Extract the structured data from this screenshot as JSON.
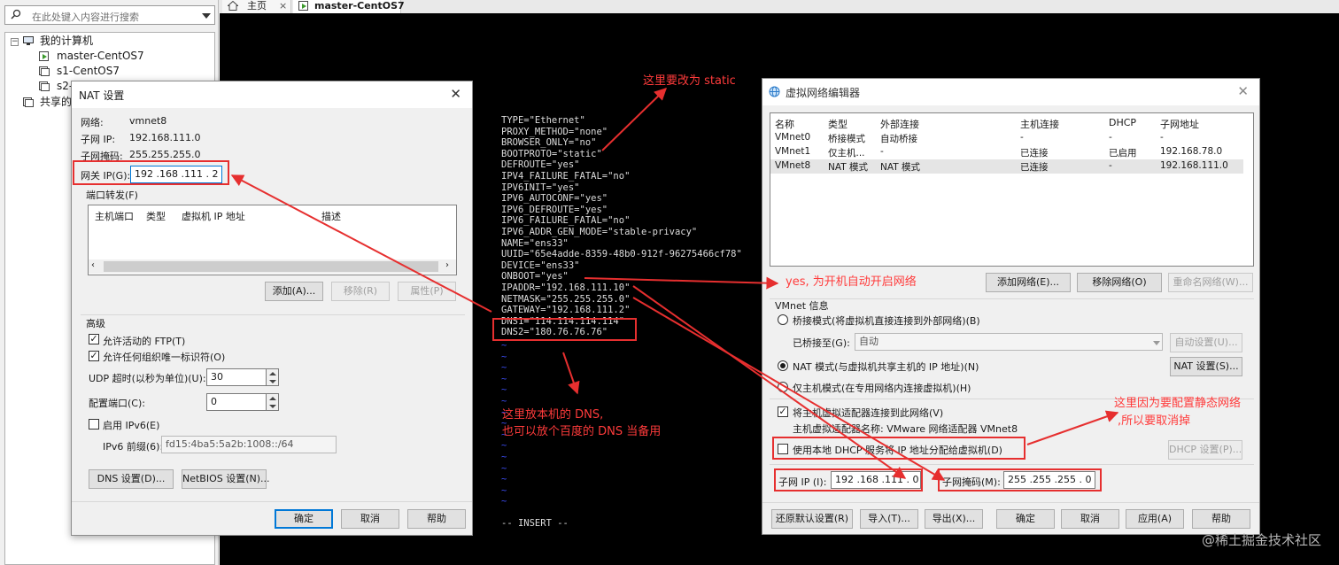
{
  "library": {
    "search_placeholder": "在此处键入内容进行搜索",
    "tree": {
      "root": "我的计算机",
      "vms": [
        "master-CentOS7",
        "s1-CentOS7",
        "s2-"
      ],
      "shared": "共享的"
    }
  },
  "tabs": [
    {
      "label": "主页"
    },
    {
      "label": "master-CentOS7"
    }
  ],
  "console": {
    "lines": [
      "TYPE=\"Ethernet\"",
      "PROXY_METHOD=\"none\"",
      "BROWSER_ONLY=\"no\"",
      "BOOTPROTO=\"static\"",
      "DEFROUTE=\"yes\"",
      "IPV4_FAILURE_FATAL=\"no\"",
      "IPV6INIT=\"yes\"",
      "IPV6_AUTOCONF=\"yes\"",
      "IPV6_DEFROUTE=\"yes\"",
      "IPV6_FAILURE_FATAL=\"no\"",
      "IPV6_ADDR_GEN_MODE=\"stable-privacy\"",
      "NAME=\"ens33\"",
      "UUID=\"65e4adde-8359-48b0-912f-96275466cf78\"",
      "DEVICE=\"ens33\"",
      "ONBOOT=\"yes\"",
      "IPADDR=\"192.168.111.10\"",
      "NETMASK=\"255.255.255.0\"",
      "GATEWAY=\"192.168.111.2\"",
      "DNS1=\"114.114.114.114\"",
      "DNS2=\"180.76.76.76\""
    ],
    "tilde": "~",
    "mode": "-- INSERT --"
  },
  "nat": {
    "title": "NAT 设置",
    "network_label": "网络:",
    "network_value": "vmnet8",
    "subnet_ip_label": "子网 IP:",
    "subnet_ip_value": "192.168.111.0",
    "subnet_mask_label": "子网掩码:",
    "subnet_mask_value": "255.255.255.0",
    "gateway_label": "网关 IP(G):",
    "gateway_value": "192 .168 .111 . 2",
    "port_forward_label": "端口转发(F)",
    "port_columns": [
      "主机端口",
      "类型",
      "虚拟机 IP 地址",
      "描述"
    ],
    "add_button": "添加(A)...",
    "remove_button": "移除(R)",
    "props_button": "属性(P)",
    "advanced_label": "高级",
    "allow_ftp": "允许活动的 FTP(T)",
    "allow_oui": "允许任何组织唯一标识符(O)",
    "udp_timeout_label": "UDP 超时(以秒为单位)(U):",
    "udp_timeout_value": "30",
    "config_port_label": "配置端口(C):",
    "config_port_value": "0",
    "enable_ipv6": "启用 IPv6(E)",
    "ipv6_prefix_label": "IPv6 前缀(6):",
    "ipv6_prefix_value": "fd15:4ba5:5a2b:1008::/64",
    "dns_button": "DNS 设置(D)...",
    "netbios_button": "NetBIOS 设置(N)...",
    "ok": "确定",
    "cancel": "取消",
    "help": "帮助"
  },
  "vne": {
    "title": "虚拟网络编辑器",
    "columns": [
      "名称",
      "类型",
      "外部连接",
      "主机连接",
      "DHCP",
      "子网地址"
    ],
    "rows": [
      [
        "VMnet0",
        "桥接模式",
        "自动桥接",
        "-",
        "-",
        "-"
      ],
      [
        "VMnet1",
        "仅主机...",
        "-",
        "已连接",
        "已启用",
        "192.168.78.0"
      ],
      [
        "VMnet8",
        "NAT 模式",
        "NAT 模式",
        "已连接",
        "-",
        "192.168.111.0"
      ]
    ],
    "add_network": "添加网络(E)...",
    "remove_network": "移除网络(O)",
    "rename_network": "重命名网络(W)...",
    "vmnet_info": "VMnet 信息",
    "bridge_mode": "桥接模式(将虚拟机直接连接到外部网络)(B)",
    "bridged_to_label": "已桥接至(G):",
    "bridged_to_value": "自动",
    "auto_settings": "自动设置(U)...",
    "nat_mode": "NAT 模式(与虚拟机共享主机的 IP 地址)(N)",
    "nat_settings": "NAT 设置(S)...",
    "host_only": "仅主机模式(在专用网络内连接虚拟机)(H)",
    "connect_adapter": "将主机虚拟适配器连接到此网络(V)",
    "adapter_name": "主机虚拟适配器名称: VMware 网络适配器 VMnet8",
    "use_dhcp": "使用本地 DHCP 服务将 IP 地址分配给虚拟机(D)",
    "dhcp_settings": "DHCP 设置(P)...",
    "subnet_ip_label": "子网 IP (I):",
    "subnet_ip_value": "192 .168 .111 . 0",
    "subnet_mask_label": "子网掩码(M):",
    "subnet_mask_value": "255 .255 .255 . 0",
    "restore": "还原默认设置(R)",
    "import": "导入(T)...",
    "export": "导出(X)...",
    "ok": "确定",
    "cancel": "取消",
    "apply": "应用(A)",
    "help": "帮助"
  },
  "annotations": {
    "static": "这里要改为 static",
    "onboot": "yes, 为开机自动开启网络",
    "dns_line1": "这里放本机的 DNS,",
    "dns_line2": "也可以放个百度的 DNS 当备用",
    "dhcp_line1": "这里因为要配置静态网络",
    "dhcp_line2": ",所以要取消掉"
  },
  "watermark": "@稀土掘金技术社区",
  "colors": {
    "annotation": "#ff3b3b",
    "highlight_box": "#e62f2f",
    "tilde": "#3b4cf0",
    "focus": "#0078d7"
  }
}
